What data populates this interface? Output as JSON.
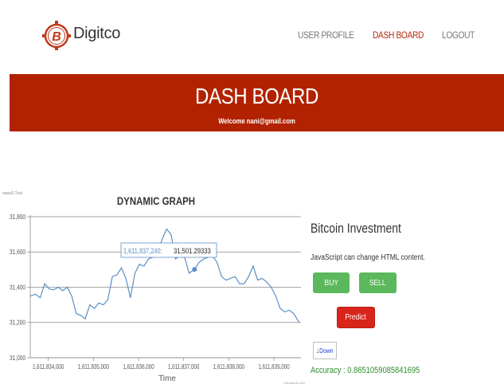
{
  "nav": {
    "brand": "Digitco",
    "links": [
      {
        "label": "USER PROFILE",
        "active": false
      },
      {
        "label": "DASH BOARD",
        "active": true
      },
      {
        "label": "LOGOUT",
        "active": false
      }
    ]
  },
  "hero": {
    "title": "DASH BOARD",
    "welcome": "Welcome nani@gmail.com"
  },
  "side": {
    "title": "Bitcoin Investment",
    "js_text": "JavaScript can change HTML content.",
    "buy_label": "BUY",
    "sell_label": "SELL",
    "predict_label": "Predict",
    "direction": "Down",
    "accuracy": "Accuracy : 0.8651059085841695"
  },
  "colors": {
    "accent": "#b22200",
    "active_link": "#b22a0c",
    "button_green": "#5cb85c",
    "button_red": "#d9241c",
    "line": "#5b8ec4",
    "accuracy_text": "#2e8b2e"
  },
  "chart_data": {
    "type": "line",
    "title": "DYNAMIC GRAPH",
    "top_left_label": "nasaS Trial",
    "xlabel": "Time",
    "ylabel": "",
    "credit": "CanvasJS.com",
    "ylim": [
      31000,
      31800
    ],
    "yticks": [
      31000,
      31200,
      31400,
      31600,
      31800
    ],
    "ytick_labels": [
      "31,000",
      "31,200",
      "31,400",
      "31,600",
      "31,800"
    ],
    "xlim": [
      1611833600,
      1611839600
    ],
    "xticks": [
      1611834000,
      1611835000,
      1611836000,
      1611837000,
      1611838000,
      1611839000
    ],
    "xtick_labels": [
      "1,611,834,000",
      "1,611,835,000",
      "1,611,836,000",
      "1,611,837,000",
      "1,611,838,000",
      "1,611,839,000"
    ],
    "grid": true,
    "tooltip": {
      "x_label": "1,611,837,240",
      "y_label": "31,501.29333",
      "x": 1611837240,
      "y": 31501.29
    },
    "series": [
      {
        "x": [
          1611833600,
          1611833720,
          1611833820,
          1611833920,
          1611834020,
          1611834120,
          1611834220,
          1611834320,
          1611834420,
          1611834520,
          1611834620,
          1611834720,
          1611834820,
          1611834920,
          1611835020,
          1611835120,
          1611835220,
          1611835320,
          1611835420,
          1611835520,
          1611835620,
          1611835720,
          1611835820,
          1611835920,
          1611836020,
          1611836120,
          1611836220,
          1611836320,
          1611836420,
          1611836520,
          1611836620,
          1611836720,
          1611836820,
          1611836920,
          1611837020,
          1611837120,
          1611837240,
          1611837340,
          1611837440,
          1611837540,
          1611837640,
          1611837740,
          1611837840,
          1611837940,
          1611838040,
          1611838140,
          1611838240,
          1611838340,
          1611838440,
          1611838540,
          1611838640,
          1611838740,
          1611838840,
          1611838940,
          1611839040,
          1611839140,
          1611839240,
          1611839340,
          1611839440,
          1611839560
        ],
        "values": [
          31350,
          31360,
          31340,
          31420,
          31390,
          31385,
          31400,
          31380,
          31400,
          31350,
          31250,
          31240,
          31220,
          31300,
          31280,
          31310,
          31300,
          31330,
          31460,
          31470,
          31510,
          31450,
          31340,
          31480,
          31530,
          31520,
          31560,
          31570,
          31600,
          31670,
          31730,
          31700,
          31560,
          31580,
          31570,
          31480,
          31501,
          31540,
          31560,
          31570,
          31580,
          31540,
          31460,
          31440,
          31450,
          31460,
          31420,
          31420,
          31460,
          31520,
          31440,
          31450,
          31430,
          31400,
          31350,
          31280,
          31260,
          31270,
          31250,
          31200
        ]
      }
    ]
  }
}
